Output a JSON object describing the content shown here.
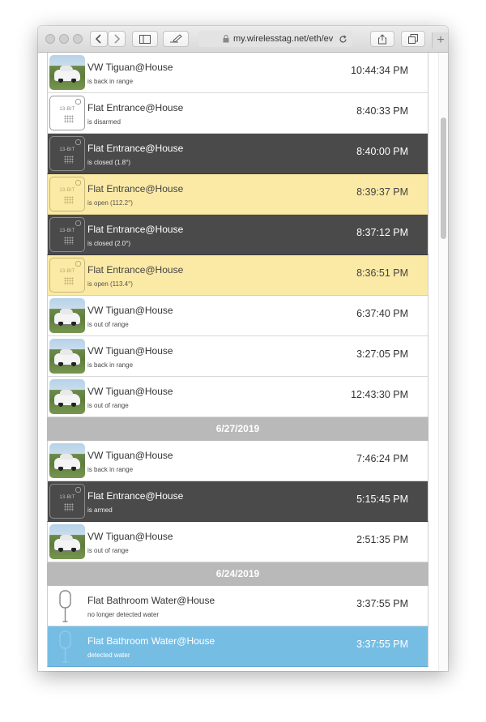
{
  "browser": {
    "url": "my.wirelesstag.net/eth/ev",
    "back_icon": "chevron-left-icon",
    "forward_icon": "chevron-right-icon",
    "new_tab": "+"
  },
  "events": [
    {
      "kind": "car",
      "style": "white",
      "name": "VW Tiguan@House",
      "status": "is back in range",
      "time": "10:44:34 PM"
    },
    {
      "kind": "tag",
      "style": "white",
      "bit": "13-BIT",
      "name": "Flat Entrance@House",
      "status": "is disarmed",
      "time": "8:40:33 PM"
    },
    {
      "kind": "tag",
      "style": "dark",
      "bit": "13-BIT",
      "name": "Flat Entrance@House",
      "status": "is closed (1.8°)",
      "time": "8:40:00 PM"
    },
    {
      "kind": "tag",
      "style": "yellow",
      "bit": "13-BIT",
      "name": "Flat Entrance@House",
      "status": "is open (112.2°)",
      "time": "8:39:37 PM"
    },
    {
      "kind": "tag",
      "style": "dark",
      "bit": "13-BIT",
      "name": "Flat Entrance@House",
      "status": "is closed (2.0°)",
      "time": "8:37:12 PM"
    },
    {
      "kind": "tag",
      "style": "yellow",
      "bit": "13-BIT",
      "name": "Flat Entrance@House",
      "status": "is open (113.4°)",
      "time": "8:36:51 PM"
    },
    {
      "kind": "car",
      "style": "white",
      "name": "VW Tiguan@House",
      "status": "is out of range",
      "time": "6:37:40 PM"
    },
    {
      "kind": "car",
      "style": "white",
      "name": "VW Tiguan@House",
      "status": "is back in range",
      "time": "3:27:05 PM"
    },
    {
      "kind": "car",
      "style": "white",
      "name": "VW Tiguan@House",
      "status": "is out of range",
      "time": "12:43:30 PM"
    },
    {
      "kind": "date",
      "label": "6/27/2019"
    },
    {
      "kind": "car",
      "style": "white",
      "name": "VW Tiguan@House",
      "status": "is back in range",
      "time": "7:46:24 PM"
    },
    {
      "kind": "tag",
      "style": "dark",
      "bit": "13-BIT",
      "name": "Flat Entrance@House",
      "status": "is armed",
      "time": "5:15:45 PM"
    },
    {
      "kind": "car",
      "style": "white",
      "name": "VW Tiguan@House",
      "status": "is out of range",
      "time": "2:51:35 PM"
    },
    {
      "kind": "date",
      "label": "6/24/2019"
    },
    {
      "kind": "water",
      "style": "white",
      "name": "Flat Bathroom Water@House",
      "status": "no longer detected water",
      "time": "3:37:55 PM"
    },
    {
      "kind": "water",
      "style": "blue",
      "name": "Flat Bathroom Water@House",
      "status": "detected water",
      "time": "3:37:55 PM"
    }
  ]
}
